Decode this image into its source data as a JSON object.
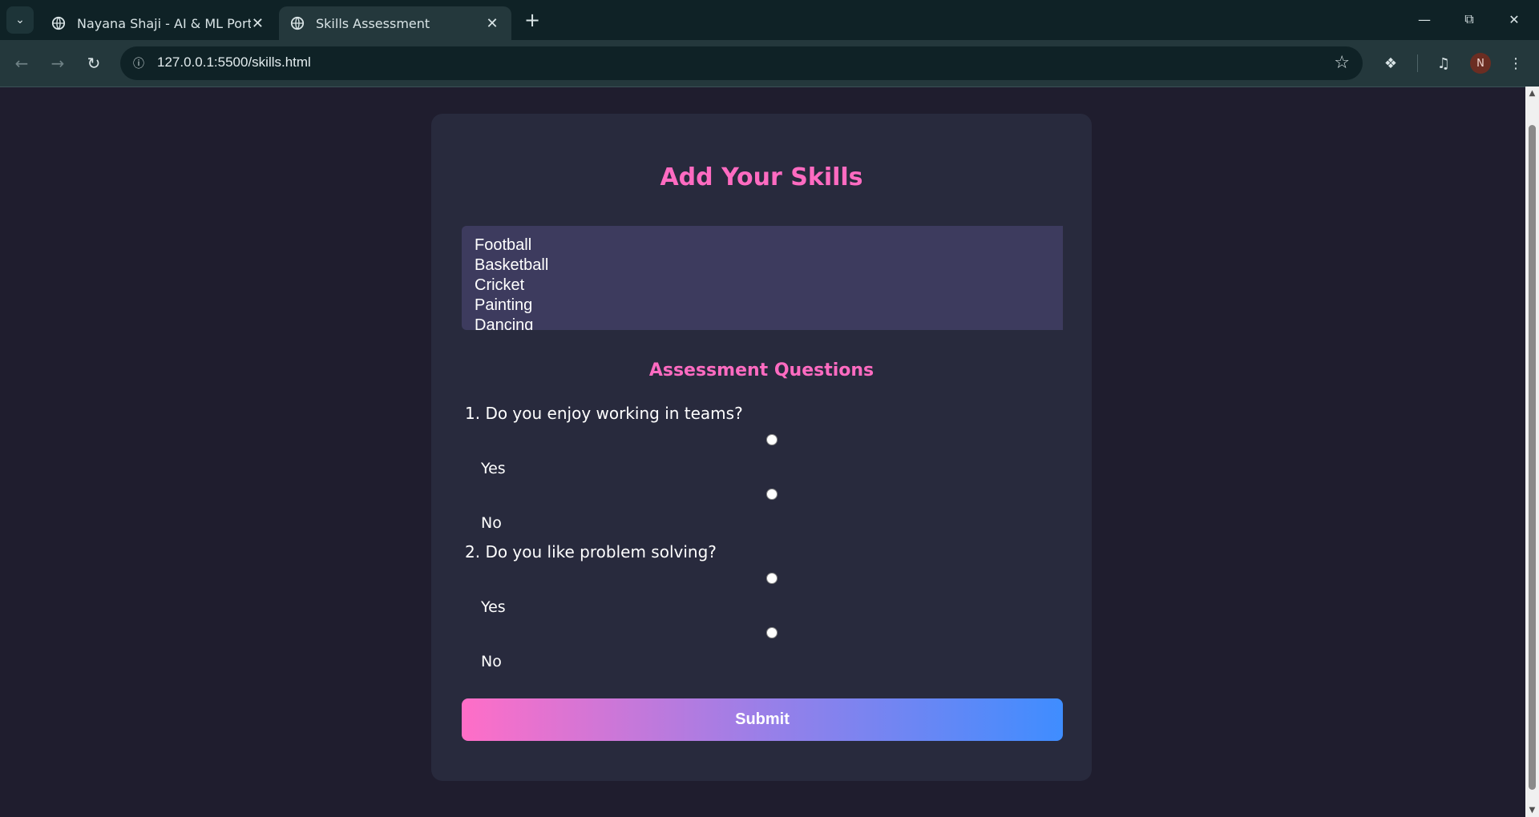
{
  "browser": {
    "tabs": [
      {
        "title": "Nayana Shaji - AI & ML Portfolio",
        "active": false
      },
      {
        "title": "Skills Assessment",
        "active": true
      }
    ],
    "url": "127.0.0.1:5500/skills.html",
    "profile_initial": "N"
  },
  "page": {
    "title": "Add Your Skills",
    "skills": [
      "Football",
      "Basketball",
      "Cricket",
      "Painting",
      "Dancing"
    ],
    "section_title": "Assessment Questions",
    "questions": [
      {
        "text": "1. Do you enjoy working in teams?",
        "options": [
          "Yes",
          "No"
        ]
      },
      {
        "text": "2. Do you like problem solving?",
        "options": [
          "Yes",
          "No"
        ]
      }
    ],
    "submit_label": "Submit"
  },
  "colors": {
    "background": "#1f1d2e",
    "card": "#282a3d",
    "accent_pink": "#ff6bc1",
    "accent_blue": "#3f8dff"
  }
}
